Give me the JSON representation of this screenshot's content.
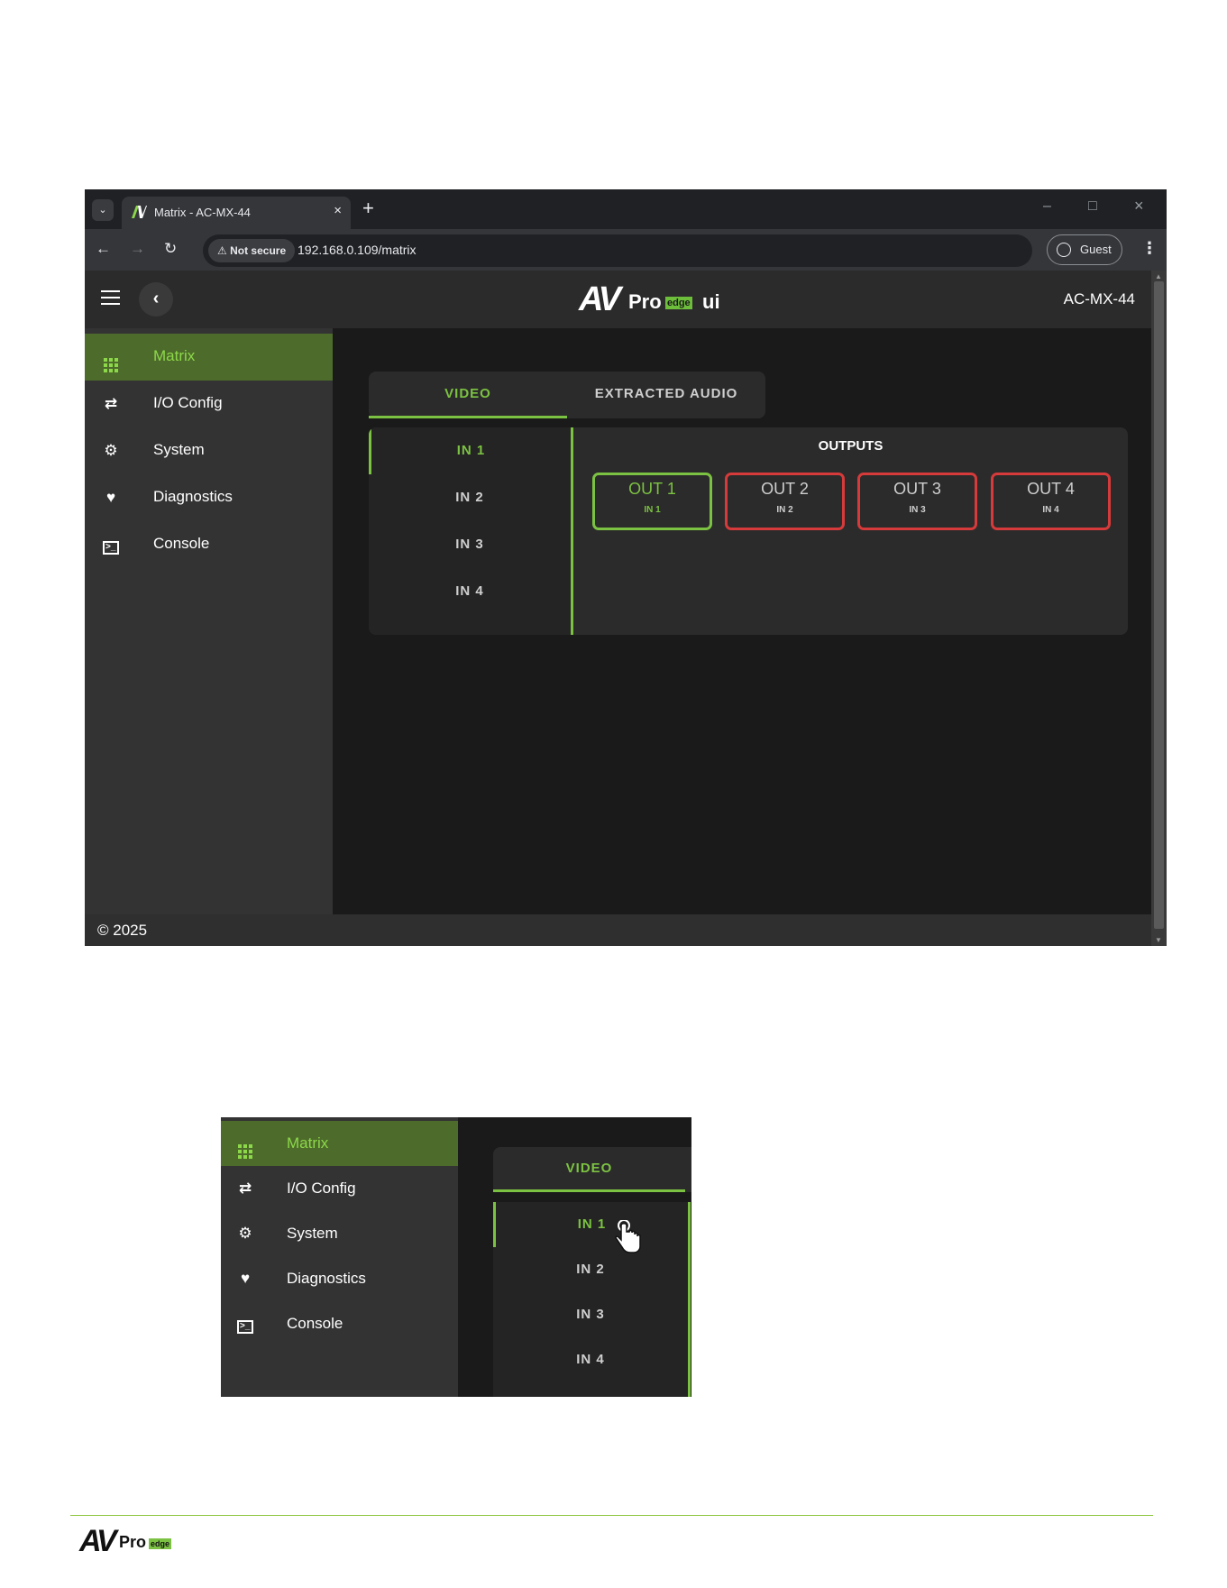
{
  "browser": {
    "tab_title": "Matrix - AC-MX-44",
    "tab_close": "×",
    "new_tab": "+",
    "security_chip": "Not secure",
    "url": "192.168.0.109/matrix",
    "profile": "Guest",
    "back": "←",
    "forward": "→",
    "reload": "↻",
    "minimize": "–",
    "maximize": "□",
    "close": "×",
    "menu": "⋮"
  },
  "app": {
    "logo": {
      "av": "AV",
      "pro": "Pro",
      "edge": "edge",
      "ui": "ui"
    },
    "device_name": "AC-MX-44",
    "back_glyph": "‹",
    "footer": "© 2025"
  },
  "sidebar": {
    "items": [
      {
        "label": "Matrix",
        "icon": "grid-icon",
        "active": true
      },
      {
        "label": "I/O Config",
        "icon": "swap-arrows-icon"
      },
      {
        "label": "System",
        "icon": "gear-icon"
      },
      {
        "label": "Diagnostics",
        "icon": "heartbeat-icon"
      },
      {
        "label": "Console",
        "icon": "terminal-icon"
      }
    ]
  },
  "tabs": [
    {
      "label": "VIDEO",
      "active": true
    },
    {
      "label": "EXTRACTED AUDIO"
    }
  ],
  "inputs": [
    "IN 1",
    "IN 2",
    "IN 3",
    "IN 4"
  ],
  "outputs": {
    "title": "OUTPUTS",
    "items": [
      {
        "name": "OUT 1",
        "source": "IN 1",
        "active": true
      },
      {
        "name": "OUT 2",
        "source": "IN 2"
      },
      {
        "name": "OUT 3",
        "source": "IN 3"
      },
      {
        "name": "OUT 4",
        "source": "IN 4"
      }
    ]
  },
  "colors": {
    "accent": "#7cc242",
    "active_bg": "#4d6b2a",
    "unselected_border": "#d63a3a"
  },
  "footer_logo": {
    "av": "AV",
    "pro": "Pro",
    "edge": "edge"
  }
}
